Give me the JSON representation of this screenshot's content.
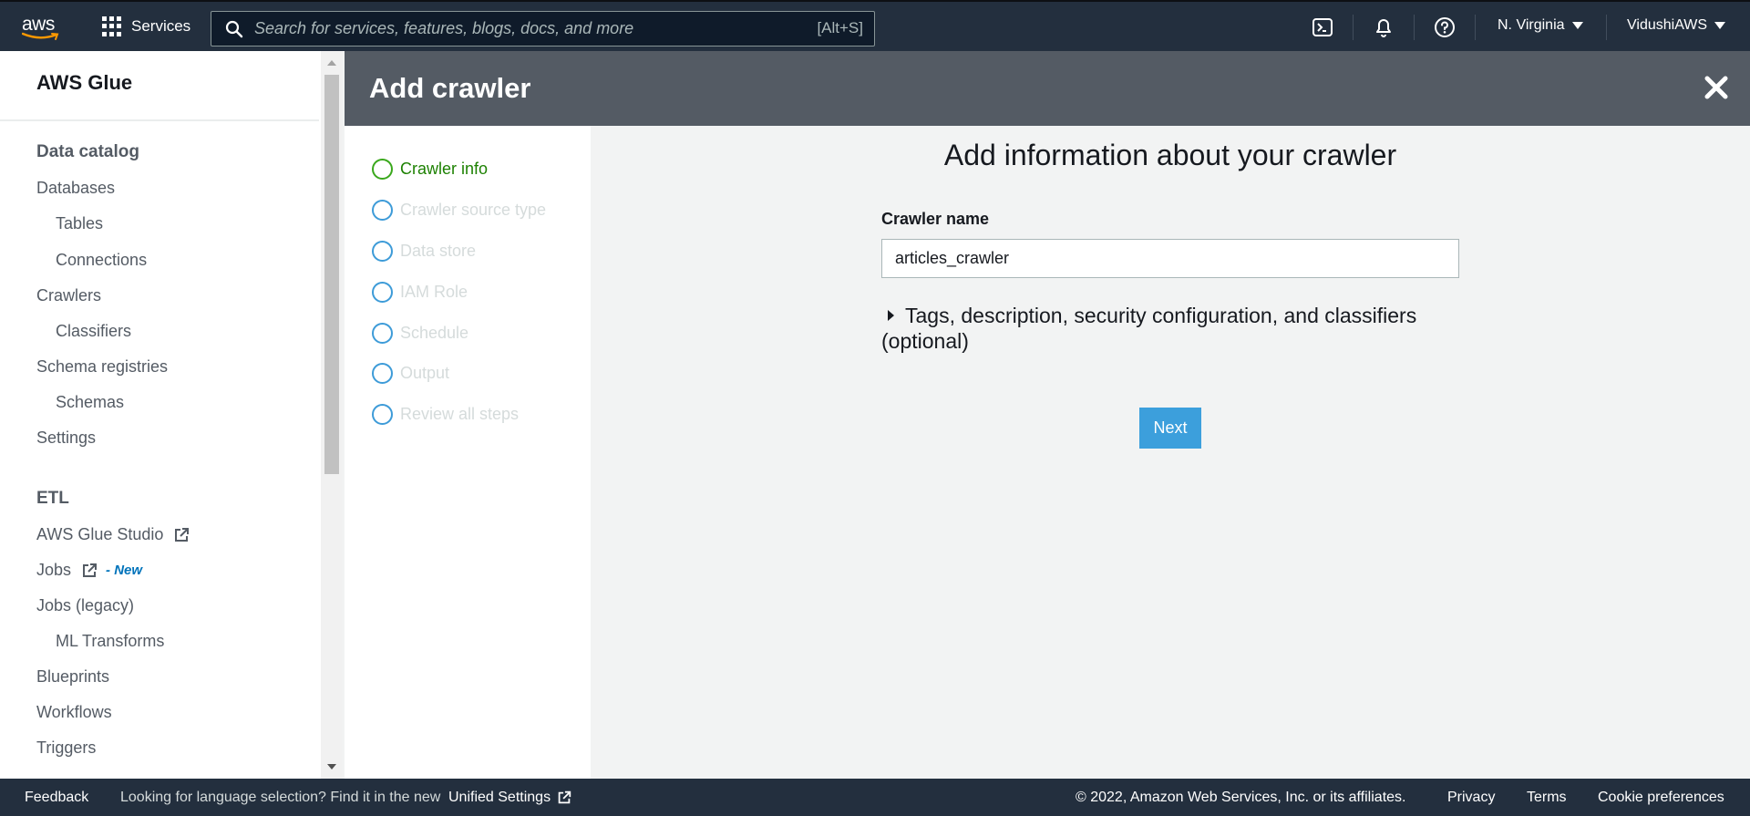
{
  "topnav": {
    "logo_text": "aws",
    "services_label": "Services",
    "search_placeholder": "Search for services, features, blogs, docs, and more",
    "search_shortcut": "[Alt+S]",
    "region": "N. Virginia",
    "account": "VidushiAWS"
  },
  "sidebar": {
    "title": "AWS Glue",
    "sections": [
      {
        "heading": "Data catalog",
        "items": [
          {
            "label": "Databases",
            "level": 1
          },
          {
            "label": "Tables",
            "level": 2
          },
          {
            "label": "Connections",
            "level": 2
          },
          {
            "label": "Crawlers",
            "level": 1
          },
          {
            "label": "Classifiers",
            "level": 2
          },
          {
            "label": "Schema registries",
            "level": 1
          },
          {
            "label": "Schemas",
            "level": 2
          },
          {
            "label": "Settings",
            "level": 1
          }
        ]
      },
      {
        "heading": "ETL",
        "items": [
          {
            "label": "AWS Glue Studio",
            "level": 1
          },
          {
            "label": "Jobs",
            "level": 1,
            "badge": "- New"
          },
          {
            "label": "Jobs (legacy)",
            "level": 1
          },
          {
            "label": "ML Transforms",
            "level": 2
          },
          {
            "label": "Blueprints",
            "level": 1
          },
          {
            "label": "Workflows",
            "level": 1
          },
          {
            "label": "Triggers",
            "level": 1
          }
        ]
      }
    ]
  },
  "panel": {
    "title": "Add crawler",
    "steps": [
      {
        "label": "Crawler info",
        "state": "active"
      },
      {
        "label": "Crawler source type",
        "state": "pending"
      },
      {
        "label": "Data store",
        "state": "pending"
      },
      {
        "label": "IAM Role",
        "state": "pending"
      },
      {
        "label": "Schedule",
        "state": "pending"
      },
      {
        "label": "Output",
        "state": "pending"
      },
      {
        "label": "Review all steps",
        "state": "pending"
      }
    ],
    "content_title": "Add information about your crawler",
    "crawler_name_label": "Crawler name",
    "crawler_name_value": "articles_crawler",
    "expander_label": "Tags, description, security configuration, and classifiers (optional)",
    "next_label": "Next"
  },
  "footer": {
    "feedback": "Feedback",
    "language_prompt": "Looking for language selection? Find it in the new",
    "unified_settings": "Unified Settings",
    "copyright": "© 2022, Amazon Web Services, Inc. or its affiliates.",
    "privacy": "Privacy",
    "terms": "Terms",
    "cookie_preferences": "Cookie preferences"
  },
  "colors": {
    "nav_bg": "#232f3e",
    "panel_header_bg": "#545b64",
    "active_step": "#1d8102",
    "step_circle": "#3d9bd8",
    "primary_button": "#3c9fdc",
    "new_badge": "#0073bb"
  }
}
